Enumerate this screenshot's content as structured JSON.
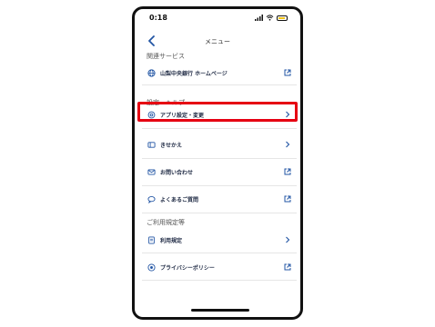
{
  "status_bar": {
    "time": "0:18"
  },
  "nav": {
    "title": "メニュー"
  },
  "sections": {
    "related": {
      "header": "関連サービス"
    },
    "settings": {
      "header": "設定・ヘルプ"
    },
    "terms": {
      "header": "ご利用規定等"
    }
  },
  "items": {
    "homepage": {
      "label": "山梨中央銀行 ホームページ",
      "icon": "globe-icon",
      "trailing": "external-link-icon"
    },
    "app_settings": {
      "label": "アプリ設定・変更",
      "icon": "gear-icon",
      "trailing": "chevron-right-icon"
    },
    "kisekae": {
      "label": "きせかえ",
      "icon": "theme-card-icon",
      "trailing": "chevron-right-icon"
    },
    "contact": {
      "label": "お問い合わせ",
      "icon": "mail-icon",
      "trailing": "external-link-icon"
    },
    "faq": {
      "label": "よくあるご質問",
      "icon": "faq-bubble-icon",
      "trailing": "external-link-icon"
    },
    "terms_of_use": {
      "label": "利用規定",
      "icon": "document-icon",
      "trailing": "chevron-right-icon"
    },
    "privacy": {
      "label": "プライバシーポリシー",
      "icon": "privacy-icon",
      "trailing": "external-link-icon"
    }
  },
  "colors": {
    "accent": "#2255a4",
    "highlight": "#e60012",
    "text": "#1f2a44"
  }
}
